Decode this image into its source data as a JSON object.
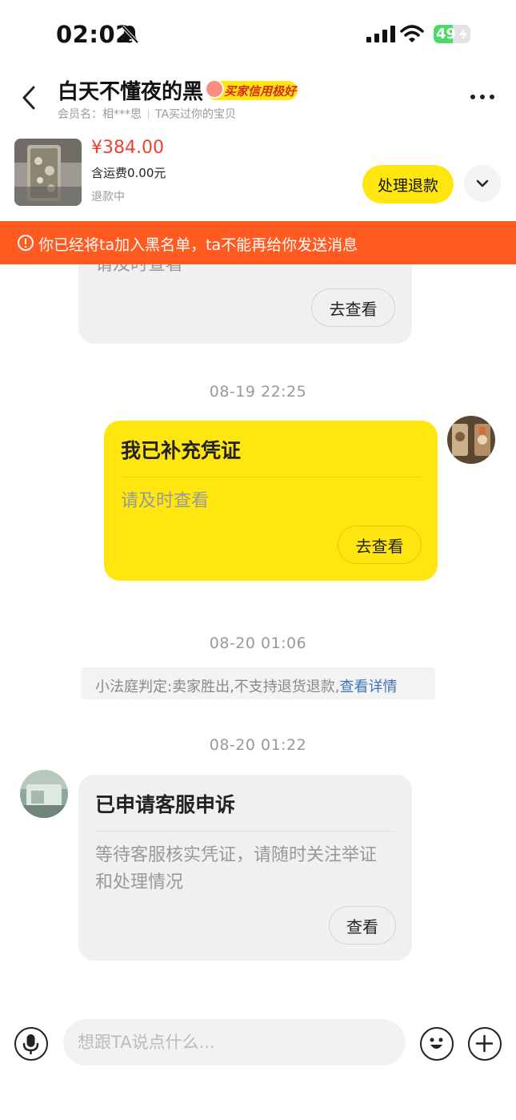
{
  "status_bar": {
    "time": "02:02",
    "battery": "49",
    "icons": [
      "bell-muted-icon",
      "cellular-signal-icon",
      "wifi-icon",
      "battery-charging-icon"
    ]
  },
  "header": {
    "title": "白天不懂夜的黑",
    "credit_badge": "买家信用极好",
    "member_label": "会员名：相***思",
    "relation": "TA买过你的宝贝",
    "icons": [
      "back-arrow-icon",
      "more-dots-icon"
    ]
  },
  "product": {
    "price": "¥384.00",
    "shipping": "含运费0.00元",
    "status": "退款中",
    "refund_button": "处理退款",
    "icons": [
      "chevron-down-icon"
    ]
  },
  "banner": {
    "text": "你已经将ta加入黑名单，ta不能再给你发送消息",
    "icon": "info-circle-icon"
  },
  "messages": {
    "first_card": {
      "body": "请及时查看",
      "button": "去查看"
    },
    "time_1": "08-19 22:25",
    "voucher_card": {
      "title": "我已补充凭证",
      "body": "请及时查看",
      "button": "去查看"
    },
    "time_2": "08-20 01:06",
    "system_notice": {
      "text": "小法庭判定:卖家胜出,不支持退货退款,",
      "link": "查看详情"
    },
    "time_3": "08-20 01:22",
    "appeal_card": {
      "title": "已申请客服申诉",
      "body": "等待客服核实凭证，请随时关注举证和处理情况",
      "button": "查看"
    }
  },
  "input_bar": {
    "placeholder": "想跟TA说点什么...",
    "icons": [
      "microphone-icon",
      "emoji-icon",
      "plus-icon"
    ]
  },
  "colors": {
    "accent_yellow": "#ffe60f",
    "banner_orange": "#ff5a1f",
    "price_red": "#f04030",
    "link_blue": "#3d74b8"
  }
}
